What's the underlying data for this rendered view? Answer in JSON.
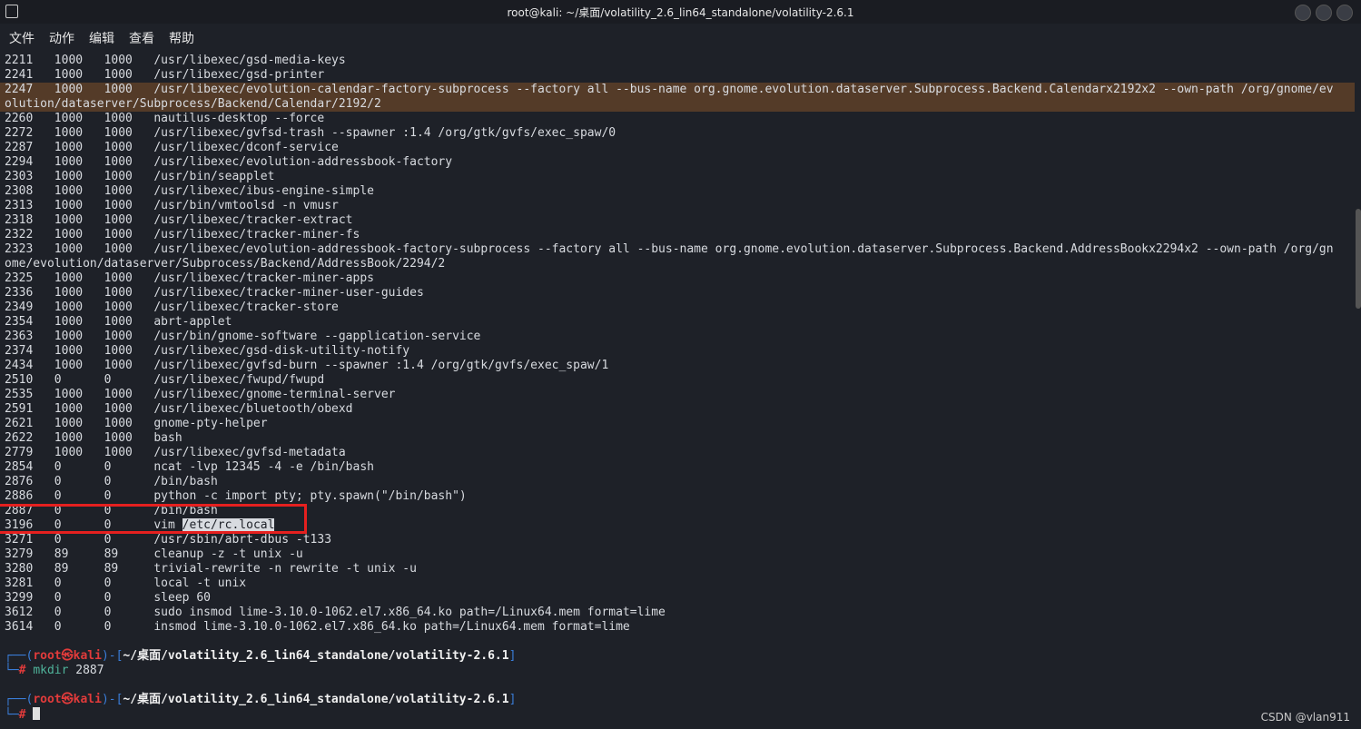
{
  "window": {
    "title": "root@kali: ~/桌面/volatility_2.6_lin64_standalone/volatility-2.6.1"
  },
  "menu": [
    "文件",
    "动作",
    "编辑",
    "查看",
    "帮助"
  ],
  "processes": [
    [
      "2211",
      "1000",
      "1000",
      "/usr/libexec/gsd-media-keys"
    ],
    [
      "2241",
      "1000",
      "1000",
      "/usr/libexec/gsd-printer"
    ],
    [
      "2247",
      "1000",
      "1000",
      "/usr/libexec/evolution-calendar-factory-subprocess --factory all --bus-name org.gnome.evolution.dataserver.Subprocess.Backend.Calendarx2192x2 --own-path /org/gnome/evolution/dataserver/Subprocess/Backend/Calendar/2192/2"
    ],
    [
      "2260",
      "1000",
      "1000",
      "nautilus-desktop --force"
    ],
    [
      "2272",
      "1000",
      "1000",
      "/usr/libexec/gvfsd-trash --spawner :1.4 /org/gtk/gvfs/exec_spaw/0"
    ],
    [
      "2287",
      "1000",
      "1000",
      "/usr/libexec/dconf-service"
    ],
    [
      "2294",
      "1000",
      "1000",
      "/usr/libexec/evolution-addressbook-factory"
    ],
    [
      "2303",
      "1000",
      "1000",
      "/usr/bin/seapplet"
    ],
    [
      "2308",
      "1000",
      "1000",
      "/usr/libexec/ibus-engine-simple"
    ],
    [
      "2313",
      "1000",
      "1000",
      "/usr/bin/vmtoolsd -n vmusr"
    ],
    [
      "2318",
      "1000",
      "1000",
      "/usr/libexec/tracker-extract"
    ],
    [
      "2322",
      "1000",
      "1000",
      "/usr/libexec/tracker-miner-fs"
    ],
    [
      "2323",
      "1000",
      "1000",
      "/usr/libexec/evolution-addressbook-factory-subprocess --factory all --bus-name org.gnome.evolution.dataserver.Subprocess.Backend.AddressBookx2294x2 --own-path /org/gnome/evolution/dataserver/Subprocess/Backend/AddressBook/2294/2"
    ],
    [
      "2325",
      "1000",
      "1000",
      "/usr/libexec/tracker-miner-apps"
    ],
    [
      "2336",
      "1000",
      "1000",
      "/usr/libexec/tracker-miner-user-guides"
    ],
    [
      "2349",
      "1000",
      "1000",
      "/usr/libexec/tracker-store"
    ],
    [
      "2354",
      "1000",
      "1000",
      "abrt-applet"
    ],
    [
      "2363",
      "1000",
      "1000",
      "/usr/bin/gnome-software --gapplication-service"
    ],
    [
      "2374",
      "1000",
      "1000",
      "/usr/libexec/gsd-disk-utility-notify"
    ],
    [
      "2434",
      "1000",
      "1000",
      "/usr/libexec/gvfsd-burn --spawner :1.4 /org/gtk/gvfs/exec_spaw/1"
    ],
    [
      "2510",
      "0",
      "0",
      "/usr/libexec/fwupd/fwupd"
    ],
    [
      "2535",
      "1000",
      "1000",
      "/usr/libexec/gnome-terminal-server"
    ],
    [
      "2591",
      "1000",
      "1000",
      "/usr/libexec/bluetooth/obexd"
    ],
    [
      "2621",
      "1000",
      "1000",
      "gnome-pty-helper"
    ],
    [
      "2622",
      "1000",
      "1000",
      "bash"
    ],
    [
      "2779",
      "1000",
      "1000",
      "/usr/libexec/gvfsd-metadata"
    ],
    [
      "2854",
      "0",
      "0",
      "ncat -lvp 12345 -4 -e /bin/bash"
    ],
    [
      "2876",
      "0",
      "0",
      "/bin/bash"
    ],
    [
      "2886",
      "0",
      "0",
      "python -c import pty; pty.spawn(\"/bin/bash\")"
    ],
    [
      "2887",
      "0",
      "0",
      "/bin/bash"
    ],
    [
      "3196",
      "0",
      "0",
      "vim /etc/rc.local"
    ],
    [
      "3271",
      "0",
      "0",
      "/usr/sbin/abrt-dbus -t133"
    ],
    [
      "3279",
      "89",
      "89",
      "cleanup -z -t unix -u"
    ],
    [
      "3280",
      "89",
      "89",
      "trivial-rewrite -n rewrite -t unix -u"
    ],
    [
      "3281",
      "0",
      "0",
      "local -t unix"
    ],
    [
      "3299",
      "0",
      "0",
      "sleep 60"
    ],
    [
      "3612",
      "0",
      "0",
      "sudo insmod lime-3.10.0-1062.el7.x86_64.ko path=/Linux64.mem format=lime"
    ],
    [
      "3614",
      "0",
      "0",
      "insmod lime-3.10.0-1062.el7.x86_64.ko path=/Linux64.mem format=lime"
    ]
  ],
  "prompt": {
    "user": "root",
    "host": "kali",
    "path": "~/桌面/volatility_2.6_lin64_standalone/volatility-2.6.1",
    "symbol": "#"
  },
  "commands": [
    "mkdir 2887",
    ""
  ],
  "selection": "/etc/rc.local",
  "watermark": "CSDN @vlan911"
}
